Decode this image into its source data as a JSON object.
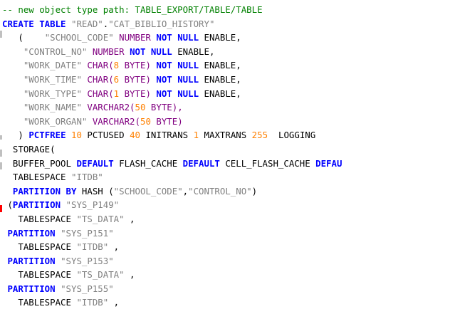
{
  "lines": [
    [
      {
        "t": "-- new object type path: TABLE_EXPORT/TABLE/TABLE",
        "c": "comment"
      }
    ],
    [
      {
        "t": "CREATE TABLE ",
        "c": "kw"
      },
      {
        "t": "\"READ\"",
        "c": "str"
      },
      {
        "t": ".",
        "c": "plain"
      },
      {
        "t": "\"CAT_BIBLIO_HISTORY\"",
        "c": "str"
      }
    ],
    [
      {
        "t": "   (    ",
        "c": "plain"
      },
      {
        "t": "\"SCHOOL_CODE\"",
        "c": "str"
      },
      {
        "t": " NUMBER ",
        "c": "type"
      },
      {
        "t": "NOT NULL",
        "c": "kw"
      },
      {
        "t": " ENABLE,",
        "c": "plain"
      }
    ],
    [
      {
        "t": "    ",
        "c": "plain"
      },
      {
        "t": "\"CONTROL_NO\"",
        "c": "str"
      },
      {
        "t": " NUMBER ",
        "c": "type"
      },
      {
        "t": "NOT NULL",
        "c": "kw"
      },
      {
        "t": " ENABLE,",
        "c": "plain"
      }
    ],
    [
      {
        "t": "    ",
        "c": "plain"
      },
      {
        "t": "\"WORK_DATE\"",
        "c": "str"
      },
      {
        "t": " CHAR(",
        "c": "type"
      },
      {
        "t": "8",
        "c": "num"
      },
      {
        "t": " BYTE) ",
        "c": "type"
      },
      {
        "t": "NOT NULL",
        "c": "kw"
      },
      {
        "t": " ENABLE,",
        "c": "plain"
      }
    ],
    [
      {
        "t": "    ",
        "c": "plain"
      },
      {
        "t": "\"WORK_TIME\"",
        "c": "str"
      },
      {
        "t": " CHAR(",
        "c": "type"
      },
      {
        "t": "6",
        "c": "num"
      },
      {
        "t": " BYTE) ",
        "c": "type"
      },
      {
        "t": "NOT NULL",
        "c": "kw"
      },
      {
        "t": " ENABLE,",
        "c": "plain"
      }
    ],
    [
      {
        "t": "    ",
        "c": "plain"
      },
      {
        "t": "\"WORK_TYPE\"",
        "c": "str"
      },
      {
        "t": " CHAR(",
        "c": "type"
      },
      {
        "t": "1",
        "c": "num"
      },
      {
        "t": " BYTE) ",
        "c": "type"
      },
      {
        "t": "NOT NULL",
        "c": "kw"
      },
      {
        "t": " ENABLE,",
        "c": "plain"
      }
    ],
    [
      {
        "t": "    ",
        "c": "plain"
      },
      {
        "t": "\"WORK_NAME\"",
        "c": "str"
      },
      {
        "t": " VARCHAR2(",
        "c": "type"
      },
      {
        "t": "50",
        "c": "num"
      },
      {
        "t": " BYTE),",
        "c": "type"
      }
    ],
    [
      {
        "t": "    ",
        "c": "plain"
      },
      {
        "t": "\"WORK_ORGAN\"",
        "c": "str"
      },
      {
        "t": " VARCHAR2(",
        "c": "type"
      },
      {
        "t": "50",
        "c": "num"
      },
      {
        "t": " BYTE)",
        "c": "type"
      }
    ],
    [
      {
        "t": "   ) ",
        "c": "plain"
      },
      {
        "t": "PCTFREE",
        "c": "kw"
      },
      {
        "t": " ",
        "c": "plain"
      },
      {
        "t": "10",
        "c": "num"
      },
      {
        "t": " PCTUSED ",
        "c": "plain"
      },
      {
        "t": "40",
        "c": "num"
      },
      {
        "t": " INITRANS ",
        "c": "plain"
      },
      {
        "t": "1",
        "c": "num"
      },
      {
        "t": " MAXTRANS ",
        "c": "plain"
      },
      {
        "t": "255",
        "c": "num"
      },
      {
        "t": "  LOGGING",
        "c": "plain"
      }
    ],
    [
      {
        "t": "  STORAGE(",
        "c": "plain"
      }
    ],
    [
      {
        "t": "  BUFFER_POOL ",
        "c": "plain"
      },
      {
        "t": "DEFAULT",
        "c": "kw"
      },
      {
        "t": " FLASH_CACHE ",
        "c": "plain"
      },
      {
        "t": "DEFAULT",
        "c": "kw"
      },
      {
        "t": " CELL_FLASH_CACHE ",
        "c": "plain"
      },
      {
        "t": "DEFAU",
        "c": "kw"
      }
    ],
    [
      {
        "t": "  TABLESPACE ",
        "c": "plain"
      },
      {
        "t": "\"ITDB\"",
        "c": "str"
      }
    ],
    [
      {
        "t": "  ",
        "c": "plain"
      },
      {
        "t": "PARTITION BY",
        "c": "kw"
      },
      {
        "t": " HASH (",
        "c": "plain"
      },
      {
        "t": "\"SCHOOL_CODE\"",
        "c": "str"
      },
      {
        "t": ",",
        "c": "plain"
      },
      {
        "t": "\"CONTROL_NO\"",
        "c": "str"
      },
      {
        "t": ")",
        "c": "plain"
      }
    ],
    [
      {
        "t": " (",
        "c": "plain"
      },
      {
        "t": "PARTITION",
        "c": "kw"
      },
      {
        "t": " ",
        "c": "plain"
      },
      {
        "t": "\"SYS_P149\"",
        "c": "str"
      }
    ],
    [
      {
        "t": "   TABLESPACE ",
        "c": "plain"
      },
      {
        "t": "\"TS_DATA\"",
        "c": "str"
      },
      {
        "t": " ,",
        "c": "plain"
      }
    ],
    [
      {
        "t": " ",
        "c": "plain"
      },
      {
        "t": "PARTITION",
        "c": "kw"
      },
      {
        "t": " ",
        "c": "plain"
      },
      {
        "t": "\"SYS_P151\"",
        "c": "str"
      }
    ],
    [
      {
        "t": "   TABLESPACE ",
        "c": "plain"
      },
      {
        "t": "\"ITDB\"",
        "c": "str"
      },
      {
        "t": " ,",
        "c": "plain"
      }
    ],
    [
      {
        "t": " ",
        "c": "plain"
      },
      {
        "t": "PARTITION",
        "c": "kw"
      },
      {
        "t": " ",
        "c": "plain"
      },
      {
        "t": "\"SYS_P153\"",
        "c": "str"
      }
    ],
    [
      {
        "t": "   TABLESPACE ",
        "c": "plain"
      },
      {
        "t": "\"TS_DATA\"",
        "c": "str"
      },
      {
        "t": " ,",
        "c": "plain"
      }
    ],
    [
      {
        "t": " ",
        "c": "plain"
      },
      {
        "t": "PARTITION",
        "c": "kw"
      },
      {
        "t": " ",
        "c": "plain"
      },
      {
        "t": "\"SYS_P155\"",
        "c": "str"
      }
    ],
    [
      {
        "t": "   TABLESPACE ",
        "c": "plain"
      },
      {
        "t": "\"ITDB\"",
        "c": "str"
      },
      {
        "t": " ,",
        "c": "plain"
      }
    ]
  ]
}
